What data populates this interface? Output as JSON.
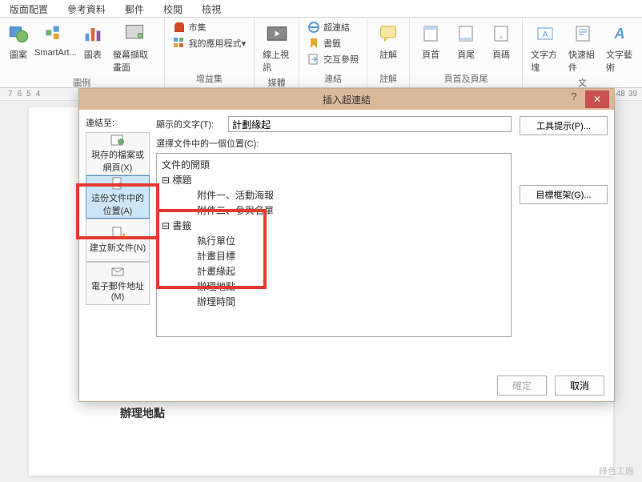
{
  "ribbon_tabs": [
    "版面配置",
    "參考資料",
    "郵件",
    "校閱",
    "檢視"
  ],
  "ribbon": {
    "illustrations": {
      "label": "圖例",
      "picture": "圖案",
      "smartart": "SmartArt...",
      "chart": "圖表",
      "screenshot": "螢幕擷取畫面"
    },
    "addins": {
      "label": "增益集",
      "store": "市集",
      "myapps": "我的應用程式"
    },
    "media": {
      "label": "媒體",
      "video": "線上視訊"
    },
    "links": {
      "label": "連結",
      "hyperlink": "超連結",
      "bookmark": "書籤",
      "crossref": "交互參照"
    },
    "comments": {
      "label": "註解",
      "comment": "註解"
    },
    "headerfooter": {
      "label": "頁首及頁尾",
      "header": "頁首",
      "footer": "頁尾",
      "pagenum": "頁碼"
    },
    "text": {
      "label": "文",
      "textbox": "文字方塊",
      "quickparts": "快速組件",
      "wordart": "文字藝術"
    }
  },
  "ruler": [
    "7",
    "6",
    "5",
    "4"
  ],
  "ruler_right": [
    "48",
    "39"
  ],
  "dialog": {
    "title": "插入超連結",
    "link_to": "連結至:",
    "options": {
      "existing": "現存的檔案或網頁(X)",
      "place": "這份文件中的位置(A)",
      "newdoc": "建立新文件(N)",
      "email": "電子郵件地址(M)"
    },
    "display_label": "顯示的文字(T):",
    "display_value": "計劃緣起",
    "screentip": "工具提示(P)...",
    "target_frame": "目標框架(G)...",
    "select_label": "選擇文件中的一個位置(C):",
    "tree": {
      "top": "文件的開頭",
      "headings": "標題",
      "heading_items": [
        "附件一、活動海報",
        "附件二、參與名單"
      ],
      "bookmarks": "書籤",
      "bookmark_items": [
        "執行單位",
        "計畫目標",
        "計畫緣起",
        "辦理地點",
        "辦理時間"
      ]
    },
    "ok": "確定",
    "cancel": "取消"
  },
  "doc_fragment": "辦理地點",
  "watermark": "綠色工廠"
}
